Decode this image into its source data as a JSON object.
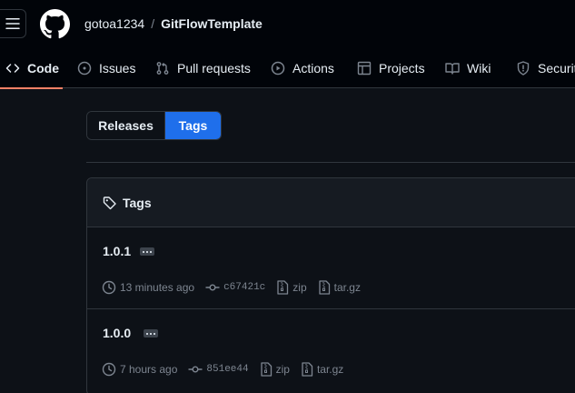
{
  "header": {
    "owner": "gotoa1234",
    "separator": "/",
    "repo": "GitFlowTemplate"
  },
  "tabs": [
    {
      "label": "Code",
      "icon": "code-icon",
      "active": true
    },
    {
      "label": "Issues",
      "icon": "issue-opened-icon"
    },
    {
      "label": "Pull requests",
      "icon": "git-pull-request-icon"
    },
    {
      "label": "Actions",
      "icon": "play-icon"
    },
    {
      "label": "Projects",
      "icon": "table-icon"
    },
    {
      "label": "Wiki",
      "icon": "book-icon"
    },
    {
      "label": "Security",
      "icon": "shield-icon"
    }
  ],
  "toggle": {
    "releases": "Releases",
    "tags": "Tags",
    "selected": "Tags"
  },
  "tags_box": {
    "title": "Tags",
    "tags": [
      {
        "name": "1.0.1",
        "time": "13 minutes ago",
        "sha": "c67421c",
        "zip": "zip",
        "targz": "tar.gz"
      },
      {
        "name": "1.0.0",
        "time": "7 hours ago",
        "sha": "851ee44",
        "zip": "zip",
        "targz": "tar.gz"
      }
    ]
  },
  "colors": {
    "background": "#0d1117",
    "header_bg": "#010409",
    "accent_blue": "#1f6feb",
    "active_underline": "#f78166",
    "border": "#30363d",
    "muted_text": "#7d8590"
  }
}
